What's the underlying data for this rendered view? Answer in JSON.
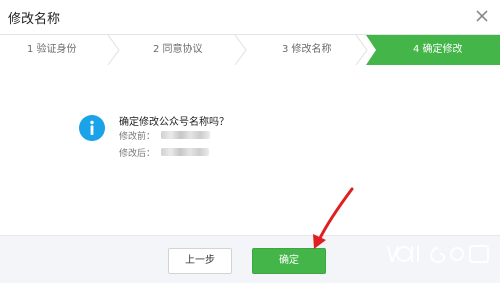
{
  "dialog": {
    "title": "修改名称",
    "close_icon": "close-icon"
  },
  "steps": [
    {
      "label": "1 验证身份",
      "active": false
    },
    {
      "label": "2 同意协议",
      "active": false
    },
    {
      "label": "3 修改名称",
      "active": false
    },
    {
      "label": "4 确定修改",
      "active": true
    }
  ],
  "content": {
    "icon": "info-icon",
    "question": "确定修改公众号名称吗？",
    "before_label": "修改前：",
    "after_label": "修改后："
  },
  "buttons": {
    "prev_label": "上一步",
    "confirm_label": "确定"
  },
  "colors": {
    "accent_green": "#44b549",
    "info_blue": "#1aa3e8",
    "annotation_red": "#e02020"
  },
  "watermark": {
    "logo": "baidu-jingyan-watermark"
  }
}
